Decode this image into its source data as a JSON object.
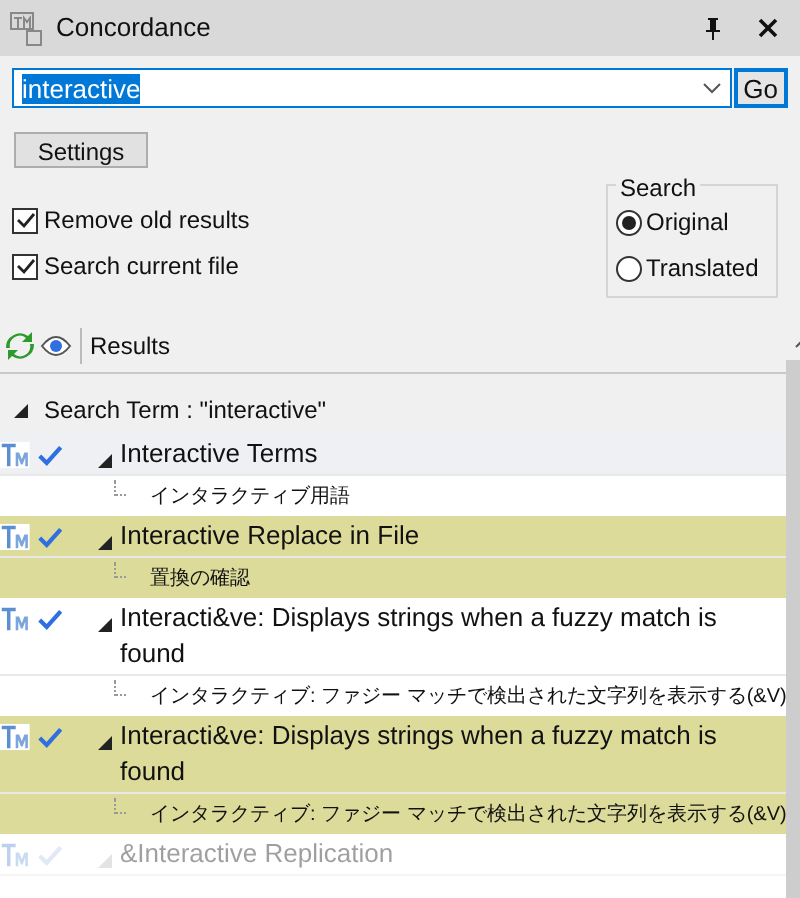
{
  "window": {
    "title": "Concordance"
  },
  "search": {
    "value": "interactive",
    "go": "Go"
  },
  "settings_button": "Settings",
  "options": [
    {
      "label": "Remove old results",
      "checked": true
    },
    {
      "label": "Search current file",
      "checked": true
    }
  ],
  "search_group": {
    "title": "Search",
    "options": [
      {
        "label": "Original",
        "selected": true
      },
      {
        "label": "Translated",
        "selected": false
      }
    ]
  },
  "results": {
    "title": "Results",
    "search_term": "Search Term : \"interactive\"",
    "entries": [
      {
        "source": "Interactive Terms",
        "target": "インタラクティブ用語",
        "selected": false,
        "faded": false
      },
      {
        "source": "Interactive Replace in File",
        "target": "置換の確認",
        "selected": true,
        "faded": false
      },
      {
        "source": "Interacti&ve: Displays strings when a fuzzy match is found",
        "target": "インタラクティブ: ファジー マッチで検出された文字列を表示する(&V)",
        "selected": false,
        "faded": false
      },
      {
        "source": "Interacti&ve: Displays strings when a fuzzy match is found",
        "target": "インタラクティブ: ファジー マッチで検出された文字列を表示する(&V)",
        "selected": true,
        "faded": false
      },
      {
        "source": "&Interactive Replication",
        "selected": false,
        "faded": true
      }
    ]
  }
}
